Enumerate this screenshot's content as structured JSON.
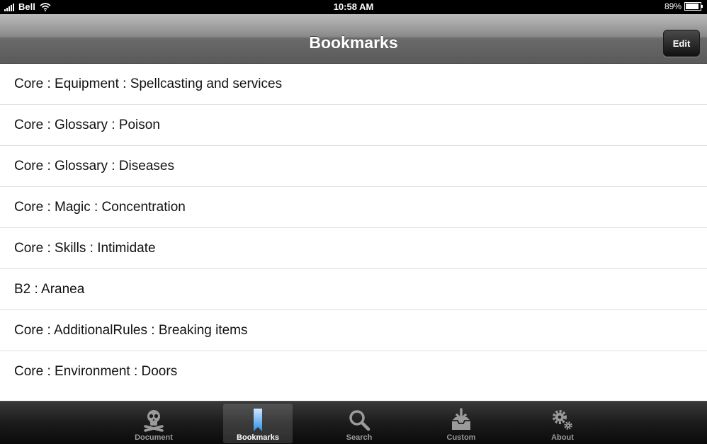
{
  "status_bar": {
    "carrier": "Bell",
    "time": "10:58 AM",
    "battery_percent": "89%",
    "battery_level": 0.89
  },
  "nav_bar": {
    "title": "Bookmarks",
    "edit_label": "Edit"
  },
  "bookmarks": [
    "Core : Equipment : Spellcasting and services",
    "Core : Glossary : Poison",
    "Core : Glossary : Diseases",
    "Core : Magic : Concentration",
    "Core : Skills : Intimidate",
    "B2 : Aranea",
    "Core : AdditionalRules : Breaking items",
    "Core : Environment : Doors"
  ],
  "tab_bar": {
    "active": "bookmarks",
    "tabs": [
      {
        "label": "Document",
        "icon": "skull-crossbones-icon"
      },
      {
        "label": "Bookmarks",
        "icon": "bookmark-icon"
      },
      {
        "label": "Search",
        "icon": "search-icon"
      },
      {
        "label": "Custom",
        "icon": "inbox-download-icon"
      },
      {
        "label": "About",
        "icon": "gears-icon"
      }
    ]
  }
}
